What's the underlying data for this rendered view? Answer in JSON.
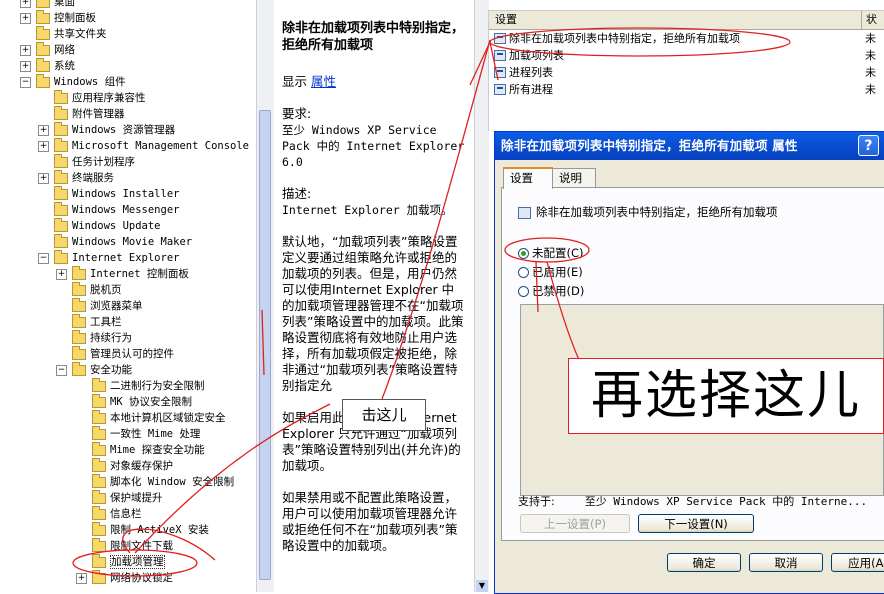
{
  "tree": {
    "items": [
      {
        "label": "桌面",
        "indent": 1,
        "expander": "+"
      },
      {
        "label": "控制面板",
        "indent": 1,
        "expander": "+"
      },
      {
        "label": "共享文件夹",
        "indent": 1,
        "expander": ""
      },
      {
        "label": "网络",
        "indent": 1,
        "expander": "+"
      },
      {
        "label": "系统",
        "indent": 1,
        "expander": "+"
      },
      {
        "label": "Windows 组件",
        "indent": 1,
        "expander": "−"
      },
      {
        "label": "应用程序兼容性",
        "indent": 2,
        "expander": ""
      },
      {
        "label": "附件管理器",
        "indent": 2,
        "expander": ""
      },
      {
        "label": "Windows 资源管理器",
        "indent": 2,
        "expander": "+"
      },
      {
        "label": "Microsoft Management Console",
        "indent": 2,
        "expander": "+"
      },
      {
        "label": "任务计划程序",
        "indent": 2,
        "expander": ""
      },
      {
        "label": "终端服务",
        "indent": 2,
        "expander": "+"
      },
      {
        "label": "Windows Installer",
        "indent": 2,
        "expander": ""
      },
      {
        "label": "Windows Messenger",
        "indent": 2,
        "expander": ""
      },
      {
        "label": "Windows Update",
        "indent": 2,
        "expander": ""
      },
      {
        "label": "Windows Movie Maker",
        "indent": 2,
        "expander": ""
      },
      {
        "label": "Internet Explorer",
        "indent": 2,
        "expander": "−"
      },
      {
        "label": "Internet 控制面板",
        "indent": 3,
        "expander": "+"
      },
      {
        "label": "脱机页",
        "indent": 3,
        "expander": ""
      },
      {
        "label": "浏览器菜单",
        "indent": 3,
        "expander": ""
      },
      {
        "label": "工具栏",
        "indent": 3,
        "expander": ""
      },
      {
        "label": "持续行为",
        "indent": 3,
        "expander": ""
      },
      {
        "label": "管理员认可的控件",
        "indent": 3,
        "expander": ""
      },
      {
        "label": "安全功能",
        "indent": 3,
        "expander": "−"
      },
      {
        "label": "二进制行为安全限制",
        "indent": 4,
        "expander": ""
      },
      {
        "label": "MK 协议安全限制",
        "indent": 4,
        "expander": ""
      },
      {
        "label": "本地计算机区域锁定安全",
        "indent": 4,
        "expander": ""
      },
      {
        "label": "一致性 Mime 处理",
        "indent": 4,
        "expander": ""
      },
      {
        "label": "Mime 探查安全功能",
        "indent": 4,
        "expander": ""
      },
      {
        "label": "对象缓存保护",
        "indent": 4,
        "expander": ""
      },
      {
        "label": "脚本化 Window 安全限制",
        "indent": 4,
        "expander": ""
      },
      {
        "label": "保护域提升",
        "indent": 4,
        "expander": ""
      },
      {
        "label": "信息栏",
        "indent": 4,
        "expander": ""
      },
      {
        "label": "限制 ActiveX 安装",
        "indent": 4,
        "expander": ""
      },
      {
        "label": "限制文件下载",
        "indent": 4,
        "expander": ""
      },
      {
        "label": "加载项管理",
        "indent": 4,
        "expander": "",
        "selected": true
      },
      {
        "label": "网络协议锁定",
        "indent": 4,
        "expander": "+"
      }
    ]
  },
  "description": {
    "title": "除非在加载项列表中特别指定，拒绝所有加载项",
    "show_label": "显示",
    "properties_link": "属性",
    "requirements_heading": "要求:",
    "requirements_text": "至少 Windows XP Service Pack 中的 Internet Explorer 6.0",
    "description_heading": "描述:",
    "description_text": "Internet Explorer 加载项。",
    "default_text": "默认地，“加载项列表”策略设置定义要通过组策略允许或拒绝的加载项的列表。但是，用户仍然可以使用Internet Explorer 中的加载项管理器管理不在“加载项列表”策略设置中的加载项。此策略设置彻底将有效地防止用户选择，所有加载项假定被拒绝，除非通过“加载项列表”策略设置特别指定允",
    "enabled_text": "如果启用此策略设置，Internet Explorer 只允许通过“加载项列表”策略设置特别列出(并允许)的加载项。",
    "disabled_text": "如果禁用或不配置此策略设置，用户可以使用加载项管理器允许或拒绝任何不在“加载项列表”策略设置中的加载项。"
  },
  "list": {
    "col_setting": "设置",
    "col_state": "状",
    "rows": [
      {
        "name": "除非在加载项列表中特别指定，拒绝所有加载项",
        "state": "未"
      },
      {
        "name": "加载项列表",
        "state": "未"
      },
      {
        "name": "进程列表",
        "state": "未"
      },
      {
        "name": "所有进程",
        "state": "未"
      }
    ]
  },
  "dialog": {
    "title": "除非在加载项列表中特别指定，拒绝所有加载项 属性",
    "help": "?",
    "tab_settings": "设置",
    "tab_explain": "说明",
    "policy_name": "除非在加载项列表中特别指定，拒绝所有加载项",
    "radio_not_configured": "未配置(C)",
    "radio_enabled": "已启用(E)",
    "radio_disabled": "已禁用(D)",
    "selected_option": "not_configured",
    "supported_label": "支持于:",
    "supported_value": "至少 Windows XP Service Pack 中的 Interne...",
    "prev_button": "上一设置(P)",
    "next_button": "下一设置(N)",
    "ok_button": "确定",
    "cancel_button": "取消",
    "apply_button": "应用(A)"
  },
  "annotations": {
    "callout_big": "再选择这儿",
    "callout_click": "击这儿",
    "color": "#e02020"
  }
}
